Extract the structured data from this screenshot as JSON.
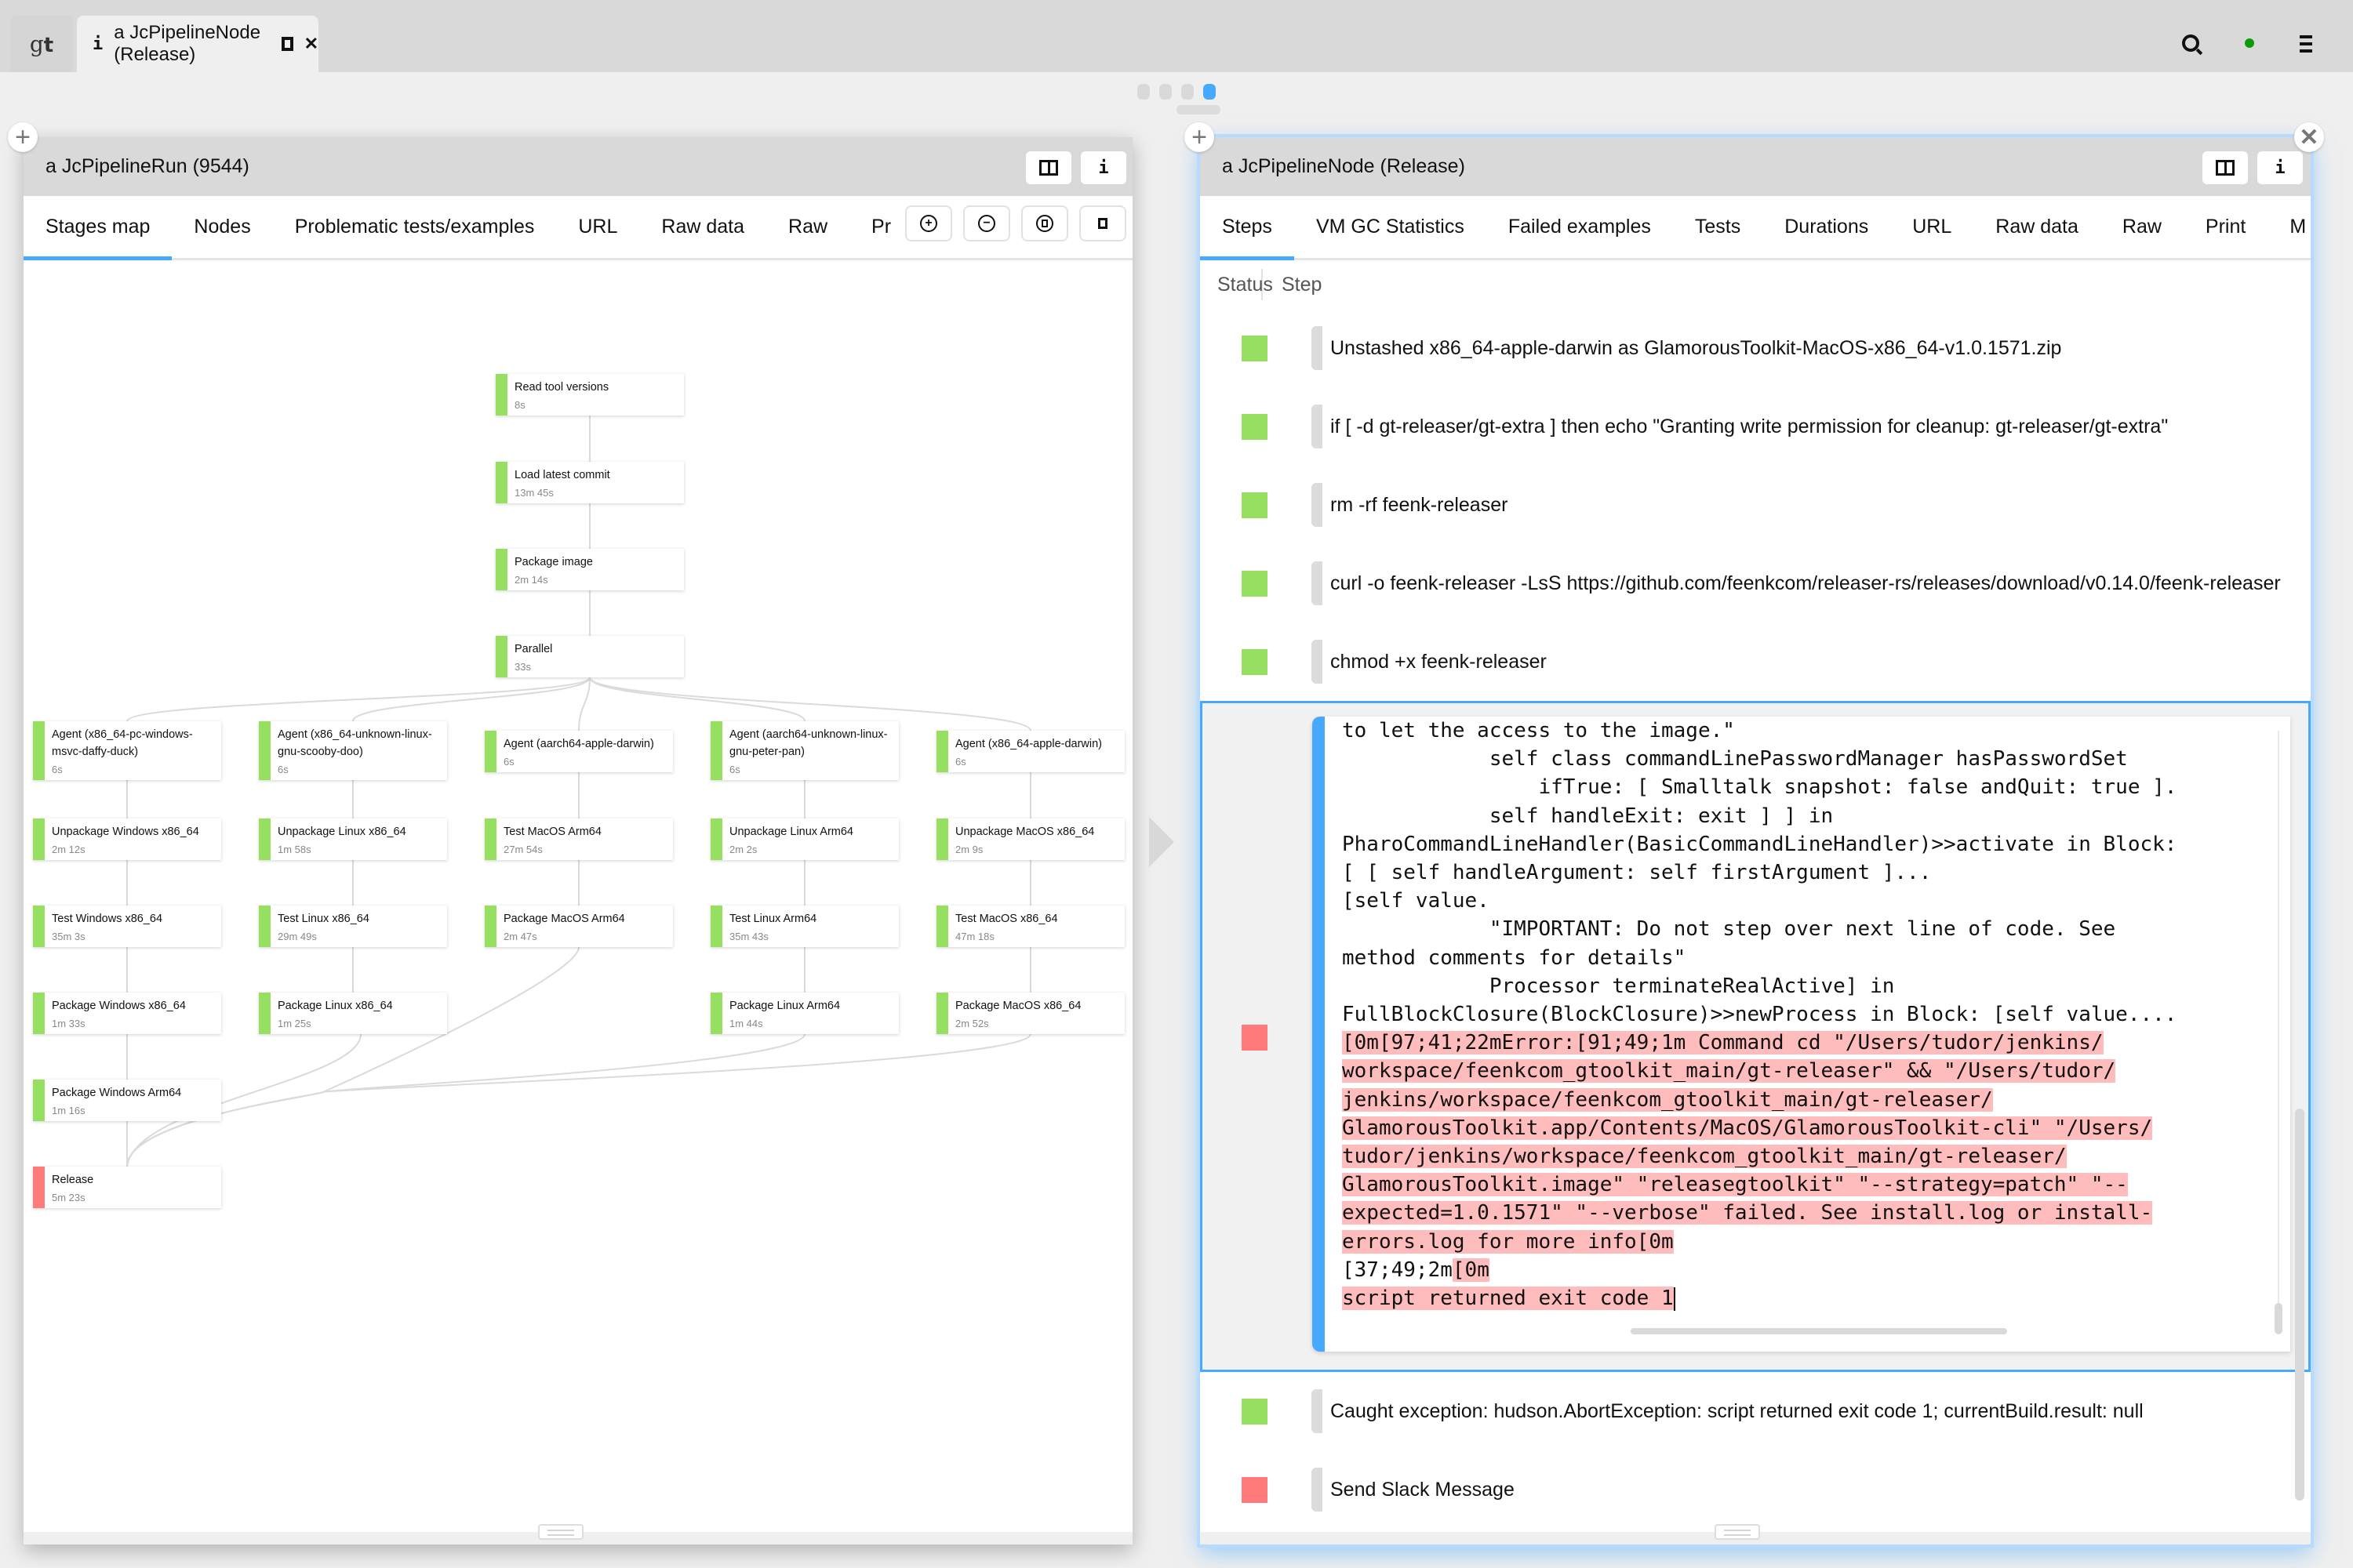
{
  "window": {
    "home_tab": "gt",
    "active_tab": {
      "icon": "info-icon",
      "label": "a JcPipelineNode (Release)"
    },
    "status_color": "#0a9a0a",
    "pager": {
      "count": 4,
      "active_index": 3
    }
  },
  "colors": {
    "accent": "#46a8ff",
    "success": "#97df60",
    "failure": "#ff7a7a",
    "error_highlight": "#ffbcbc"
  },
  "left_pane": {
    "title": "a JcPipelineRun (9544)",
    "tabs": [
      "Stages map",
      "Nodes",
      "Problematic tests/examples",
      "URL",
      "Raw data",
      "Raw",
      "Pr"
    ],
    "active_tab": 0,
    "tools": [
      "zoom-in",
      "zoom-out",
      "zoom-to-fit",
      "actual-size"
    ],
    "stages": [
      {
        "id": "read",
        "name": "Read tool versions",
        "duration": "8s",
        "status": "success"
      },
      {
        "id": "load",
        "name": "Load latest commit",
        "duration": "13m 45s",
        "status": "success"
      },
      {
        "id": "pkgimg",
        "name": "Package image",
        "duration": "2m 14s",
        "status": "success"
      },
      {
        "id": "parallel",
        "name": "Parallel",
        "duration": "33s",
        "status": "success"
      },
      {
        "id": "ag_win",
        "name": "Agent (x86_64-pc-windows-msvc-daffy-duck)",
        "duration": "6s",
        "status": "success"
      },
      {
        "id": "ag_lin",
        "name": "Agent (x86_64-unknown-linux-gnu-scooby-doo)",
        "duration": "6s",
        "status": "success"
      },
      {
        "id": "ag_macarm",
        "name": "Agent (aarch64-apple-darwin)",
        "duration": "6s",
        "status": "success"
      },
      {
        "id": "ag_linarm",
        "name": "Agent (aarch64-unknown-linux-gnu-peter-pan)",
        "duration": "6s",
        "status": "success"
      },
      {
        "id": "ag_mac",
        "name": "Agent (x86_64-apple-darwin)",
        "duration": "6s",
        "status": "success"
      },
      {
        "id": "unp_win",
        "name": "Unpackage Windows x86_64",
        "duration": "2m 12s",
        "status": "success"
      },
      {
        "id": "unp_lin",
        "name": "Unpackage Linux x86_64",
        "duration": "1m 58s",
        "status": "success"
      },
      {
        "id": "test_macarm",
        "name": "Test MacOS Arm64",
        "duration": "27m 54s",
        "status": "success"
      },
      {
        "id": "unp_linarm",
        "name": "Unpackage Linux Arm64",
        "duration": "2m 2s",
        "status": "success"
      },
      {
        "id": "unp_mac",
        "name": "Unpackage MacOS x86_64",
        "duration": "2m 9s",
        "status": "success"
      },
      {
        "id": "test_win",
        "name": "Test Windows x86_64",
        "duration": "35m 3s",
        "status": "success"
      },
      {
        "id": "test_lin",
        "name": "Test Linux x86_64",
        "duration": "29m 49s",
        "status": "success"
      },
      {
        "id": "pkg_macarm",
        "name": "Package MacOS Arm64",
        "duration": "2m 47s",
        "status": "success"
      },
      {
        "id": "test_linarm",
        "name": "Test Linux Arm64",
        "duration": "35m 43s",
        "status": "success"
      },
      {
        "id": "test_mac",
        "name": "Test MacOS x86_64",
        "duration": "47m 18s",
        "status": "success"
      },
      {
        "id": "pkg_win",
        "name": "Package Windows x86_64",
        "duration": "1m 33s",
        "status": "success"
      },
      {
        "id": "pkg_lin",
        "name": "Package Linux x86_64",
        "duration": "1m 25s",
        "status": "success"
      },
      {
        "id": "pkg_linarm",
        "name": "Package Linux Arm64",
        "duration": "1m 44s",
        "status": "success"
      },
      {
        "id": "pkg_mac",
        "name": "Package MacOS x86_64",
        "duration": "2m 52s",
        "status": "success"
      },
      {
        "id": "pkg_winarm",
        "name": "Package Windows Arm64",
        "duration": "1m 16s",
        "status": "success"
      },
      {
        "id": "release",
        "name": "Release",
        "duration": "5m 23s",
        "status": "failure"
      }
    ],
    "edges": [
      [
        "read",
        "load"
      ],
      [
        "load",
        "pkgimg"
      ],
      [
        "pkgimg",
        "parallel"
      ],
      [
        "parallel",
        "ag_win"
      ],
      [
        "parallel",
        "ag_lin"
      ],
      [
        "parallel",
        "ag_macarm"
      ],
      [
        "parallel",
        "ag_linarm"
      ],
      [
        "parallel",
        "ag_mac"
      ],
      [
        "ag_win",
        "unp_win"
      ],
      [
        "unp_win",
        "test_win"
      ],
      [
        "test_win",
        "pkg_win"
      ],
      [
        "pkg_win",
        "pkg_winarm"
      ],
      [
        "ag_lin",
        "unp_lin"
      ],
      [
        "unp_lin",
        "test_lin"
      ],
      [
        "test_lin",
        "pkg_lin"
      ],
      [
        "ag_macarm",
        "test_macarm"
      ],
      [
        "test_macarm",
        "pkg_macarm"
      ],
      [
        "ag_linarm",
        "unp_linarm"
      ],
      [
        "unp_linarm",
        "test_linarm"
      ],
      [
        "test_linarm",
        "pkg_linarm"
      ],
      [
        "ag_mac",
        "unp_mac"
      ],
      [
        "unp_mac",
        "test_mac"
      ],
      [
        "test_mac",
        "pkg_mac"
      ],
      [
        "pkg_winarm",
        "release"
      ],
      [
        "pkg_lin",
        "release"
      ],
      [
        "pkg_macarm",
        "release"
      ],
      [
        "pkg_linarm",
        "release"
      ],
      [
        "pkg_mac",
        "release"
      ]
    ]
  },
  "right_pane": {
    "title": "a JcPipelineNode (Release)",
    "tabs": [
      "Steps",
      "VM GC Statistics",
      "Failed examples",
      "Tests",
      "Durations",
      "URL",
      "Raw data",
      "Raw",
      "Print",
      "M"
    ],
    "active_tab": 0,
    "columns": [
      "Status",
      "Step"
    ],
    "steps_before": [
      {
        "status": "success",
        "text": "Unstashed x86_64-apple-darwin as GlamorousToolkit-MacOS-x86_64-v1.0.1571.zip"
      },
      {
        "status": "success",
        "text": "if [ -d gt-releaser/gt-extra ]           then              echo \"Granting write permission for cleanup: gt-releaser/gt-extra\""
      },
      {
        "status": "success",
        "text": "rm -rf feenk-releaser"
      },
      {
        "status": "success",
        "text": "curl -o feenk-releaser -LsS https://github.com/feenkcom/releaser-rs/releases/download/v0.14.0/feenk-releaser"
      },
      {
        "status": "success",
        "text": "chmod +x feenk-releaser"
      }
    ],
    "expanded_step": {
      "status": "failure",
      "log_lines": [
        "to let the access to the image.\"",
        "            self class commandLinePasswordManager hasPasswordSet",
        "                ifTrue: [ Smalltalk snapshot: false andQuit: true ].",
        "            self handleExit: exit ] ] in",
        "PharoCommandLineHandler(BasicCommandLineHandler)>>activate in Block:",
        "[ [ self handleArgument: self firstArgument ]...",
        "[self value.",
        "            \"IMPORTANT: Do not step over next line of code. See",
        "method comments for details\"",
        "            Processor terminateRealActive] in",
        "FullBlockClosure(BlockClosure)>>newProcess in Block: [self value...."
      ],
      "error_lines": [
        "[0m[97;41;22mError:[91;49;1m Command cd \"/Users/tudor/jenkins/",
        "workspace/feenkcom_gtoolkit_main/gt-releaser\" && \"/Users/tudor/",
        "jenkins/workspace/feenkcom_gtoolkit_main/gt-releaser/",
        "GlamorousToolkit.app/Contents/MacOS/GlamorousToolkit-cli\" \"/Users/",
        "tudor/jenkins/workspace/feenkcom_gtoolkit_main/gt-releaser/",
        "GlamorousToolkit.image\" \"releasegtoolkit\" \"--strategy=patch\" \"--",
        "expected=1.0.1571\" \"--verbose\" failed. See install.log or install-",
        "errors.log for more info[0m"
      ],
      "mixed_line": {
        "plain": "[37;49;2m",
        "highlighted": "[0m"
      },
      "last_line": "script returned exit code 1"
    },
    "steps_after": [
      {
        "status": "success",
        "text": "Caught exception: hudson.AbortException: script returned exit code 1; currentBuild.result: null"
      },
      {
        "status": "failure",
        "text": "Send Slack Message"
      }
    ]
  }
}
